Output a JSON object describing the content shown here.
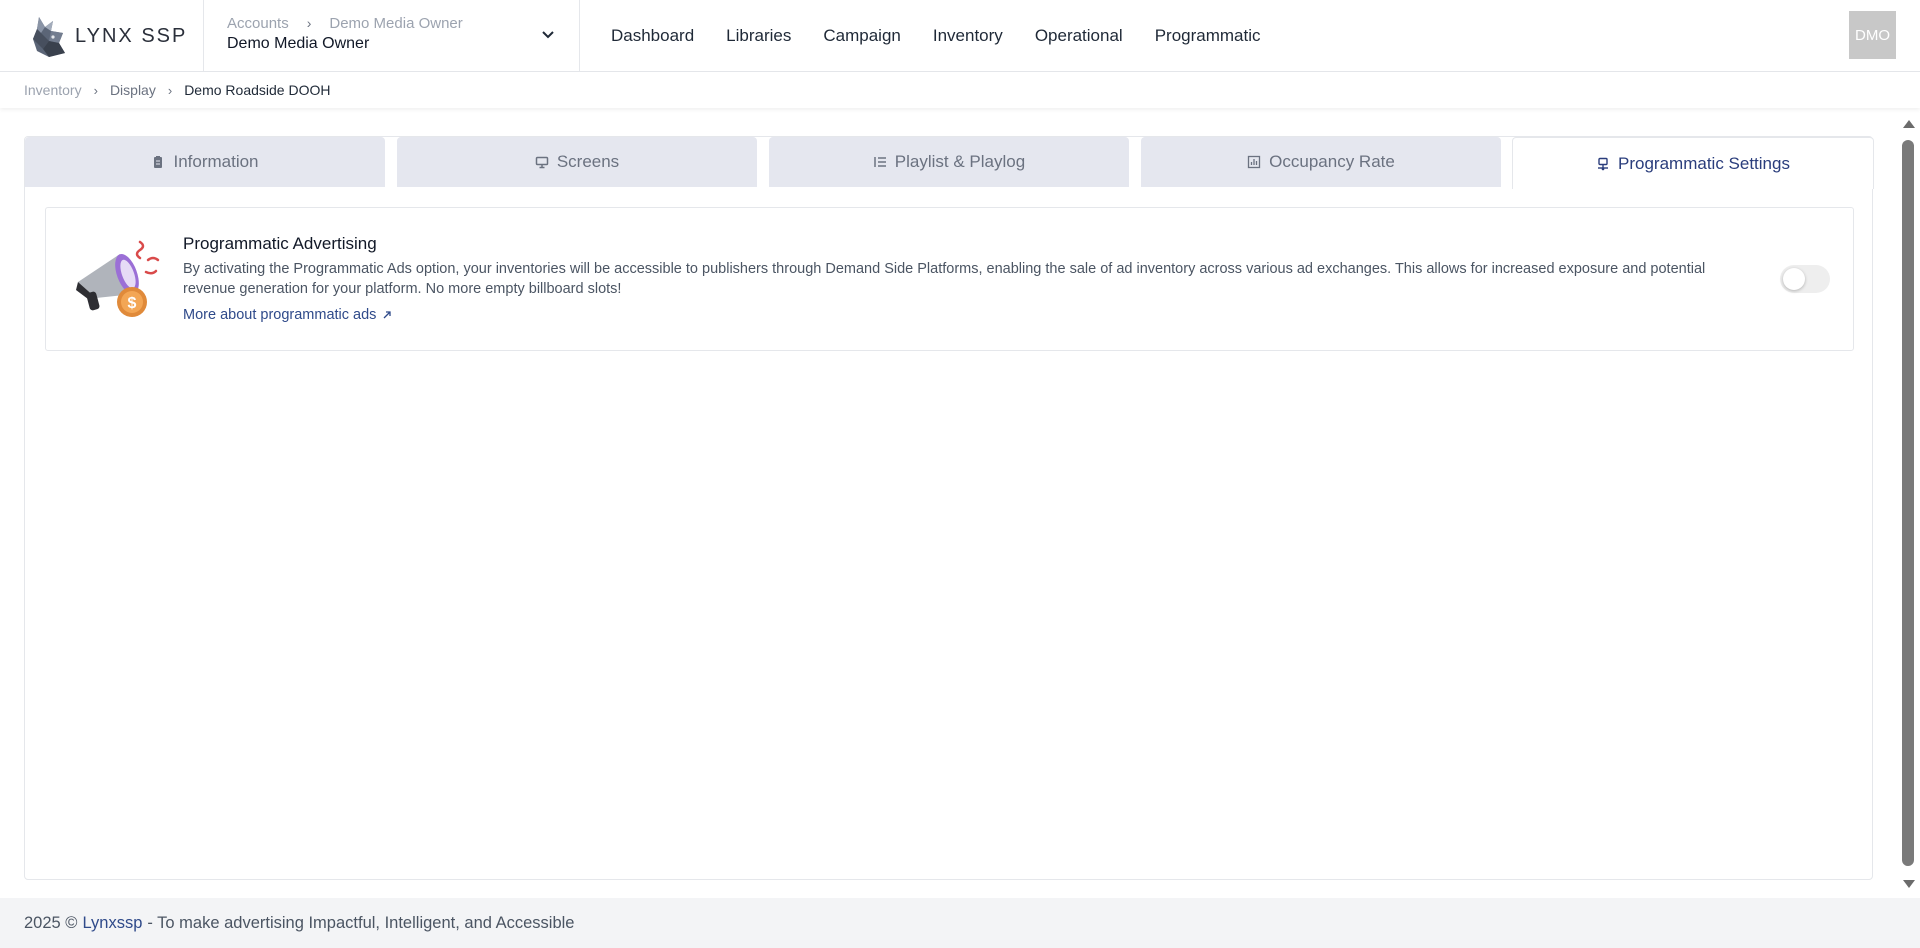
{
  "header": {
    "logo_text": "LYNX SSP",
    "account": {
      "crumbs": [
        "Accounts",
        "Demo Media Owner"
      ],
      "name": "Demo Media Owner"
    },
    "nav": [
      "Dashboard",
      "Libraries",
      "Campaign",
      "Inventory",
      "Operational",
      "Programmatic"
    ],
    "avatar_initials": "DMO"
  },
  "breadcrumb": {
    "items": [
      "Inventory",
      "Display"
    ],
    "current": "Demo Roadside DOOH"
  },
  "tabs": [
    {
      "label": "Information",
      "icon": "clipboard-icon",
      "active": false
    },
    {
      "label": "Screens",
      "icon": "monitor-icon",
      "active": false
    },
    {
      "label": "Playlist & Playlog",
      "icon": "list-icon",
      "active": false
    },
    {
      "label": "Occupancy Rate",
      "icon": "bar-chart-icon",
      "active": false
    },
    {
      "label": "Programmatic Settings",
      "icon": "network-icon",
      "active": true
    }
  ],
  "programmatic": {
    "title": "Programmatic Advertising",
    "description": "By activating the Programmatic Ads option, your inventories will be accessible to publishers through Demand Side Platforms, enabling the sale of ad inventory across various ad exchanges. This allows for increased exposure and potential revenue generation for your platform. No more empty billboard slots!",
    "link_label": "More about programmatic ads",
    "enabled": false
  },
  "footer": {
    "prefix": "2025 ©",
    "brand": "Lynxssp",
    "tagline": "- To make advertising Impactful, Intelligent, and Accessible"
  },
  "colors": {
    "accent": "#2a3d7c",
    "link": "#2f4a8a",
    "tab_inactive_bg": "#e5e7ef",
    "footer_bg": "#f3f4f6"
  }
}
